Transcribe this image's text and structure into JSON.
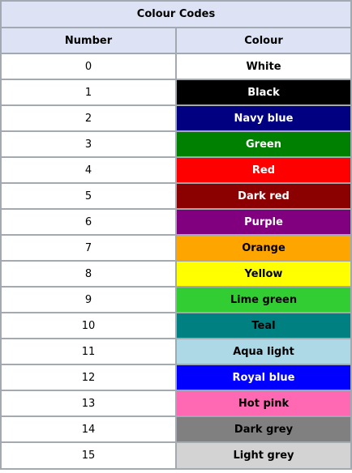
{
  "table": {
    "caption": "Colour Codes",
    "headers": {
      "number": "Number",
      "colour": "Colour"
    },
    "rows": [
      {
        "number": "0",
        "name": "White",
        "bg": "#ffffff",
        "fg": "#000000"
      },
      {
        "number": "1",
        "name": "Black",
        "bg": "#000000",
        "fg": "#ffffff"
      },
      {
        "number": "2",
        "name": "Navy blue",
        "bg": "#000080",
        "fg": "#ffffff"
      },
      {
        "number": "3",
        "name": "Green",
        "bg": "#008000",
        "fg": "#ffffff"
      },
      {
        "number": "4",
        "name": "Red",
        "bg": "#ff0000",
        "fg": "#ffffff"
      },
      {
        "number": "5",
        "name": "Dark red",
        "bg": "#8b0000",
        "fg": "#ffffff"
      },
      {
        "number": "6",
        "name": "Purple",
        "bg": "#800080",
        "fg": "#ffffff"
      },
      {
        "number": "7",
        "name": "Orange",
        "bg": "#ffa500",
        "fg": "#000000"
      },
      {
        "number": "8",
        "name": "Yellow",
        "bg": "#ffff00",
        "fg": "#000000"
      },
      {
        "number": "9",
        "name": "Lime green",
        "bg": "#32cd32",
        "fg": "#000000"
      },
      {
        "number": "10",
        "name": "Teal",
        "bg": "#008080",
        "fg": "#000000"
      },
      {
        "number": "11",
        "name": "Aqua light",
        "bg": "#add8e6",
        "fg": "#000000"
      },
      {
        "number": "12",
        "name": "Royal blue",
        "bg": "#0000ff",
        "fg": "#ffffff"
      },
      {
        "number": "13",
        "name": "Hot pink",
        "bg": "#ff69b4",
        "fg": "#000000"
      },
      {
        "number": "14",
        "name": "Dark grey",
        "bg": "#808080",
        "fg": "#000000"
      },
      {
        "number": "15",
        "name": "Light grey",
        "bg": "#d3d3d3",
        "fg": "#000000"
      }
    ]
  },
  "colors": {
    "header_background": "#dde3f5",
    "border": "#a2a9b1"
  }
}
